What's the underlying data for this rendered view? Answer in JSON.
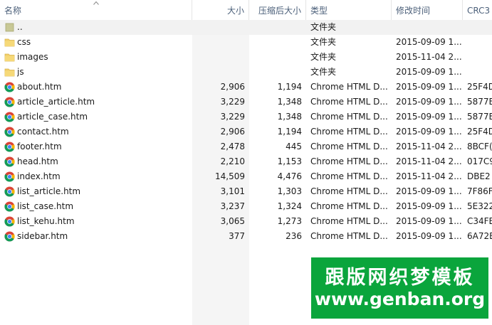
{
  "columns": {
    "name": "名称",
    "size": "大小",
    "packed": "压缩后大小",
    "type": "类型",
    "modified": "修改时间",
    "crc": "CRC3"
  },
  "files": [
    {
      "name": "..",
      "icon": "folder-up-icon",
      "size": "",
      "packed": "",
      "type": "文件夹",
      "modified": "",
      "crc": ""
    },
    {
      "name": "css",
      "icon": "folder-icon",
      "size": "",
      "packed": "",
      "type": "文件夹",
      "modified": "2015-09-09 1...",
      "crc": ""
    },
    {
      "name": "images",
      "icon": "folder-icon",
      "size": "",
      "packed": "",
      "type": "文件夹",
      "modified": "2015-11-04 2...",
      "crc": ""
    },
    {
      "name": "js",
      "icon": "folder-icon",
      "size": "",
      "packed": "",
      "type": "文件夹",
      "modified": "2015-09-09 1...",
      "crc": ""
    },
    {
      "name": "about.htm",
      "icon": "chrome-icon",
      "size": "2,906",
      "packed": "1,194",
      "type": "Chrome HTML D...",
      "modified": "2015-09-09 1...",
      "crc": "25F4D"
    },
    {
      "name": "article_article.htm",
      "icon": "chrome-icon",
      "size": "3,229",
      "packed": "1,348",
      "type": "Chrome HTML D...",
      "modified": "2015-09-09 1...",
      "crc": "5877E"
    },
    {
      "name": "article_case.htm",
      "icon": "chrome-icon",
      "size": "3,229",
      "packed": "1,348",
      "type": "Chrome HTML D...",
      "modified": "2015-09-09 1...",
      "crc": "5877E"
    },
    {
      "name": "contact.htm",
      "icon": "chrome-icon",
      "size": "2,906",
      "packed": "1,194",
      "type": "Chrome HTML D...",
      "modified": "2015-09-09 1...",
      "crc": "25F4D"
    },
    {
      "name": "footer.htm",
      "icon": "chrome-icon",
      "size": "2,478",
      "packed": "445",
      "type": "Chrome HTML D...",
      "modified": "2015-11-04 2...",
      "crc": "8BCF("
    },
    {
      "name": "head.htm",
      "icon": "chrome-icon",
      "size": "2,210",
      "packed": "1,153",
      "type": "Chrome HTML D...",
      "modified": "2015-11-04 2...",
      "crc": "017C9"
    },
    {
      "name": "index.htm",
      "icon": "chrome-icon",
      "size": "14,509",
      "packed": "4,476",
      "type": "Chrome HTML D...",
      "modified": "2015-11-04 2...",
      "crc": "DBE2"
    },
    {
      "name": "list_article.htm",
      "icon": "chrome-icon",
      "size": "3,101",
      "packed": "1,303",
      "type": "Chrome HTML D...",
      "modified": "2015-09-09 1...",
      "crc": "7F86F"
    },
    {
      "name": "list_case.htm",
      "icon": "chrome-icon",
      "size": "3,237",
      "packed": "1,324",
      "type": "Chrome HTML D...",
      "modified": "2015-09-09 1...",
      "crc": "5E322"
    },
    {
      "name": "list_kehu.htm",
      "icon": "chrome-icon",
      "size": "3,065",
      "packed": "1,273",
      "type": "Chrome HTML D...",
      "modified": "2015-09-09 1...",
      "crc": "C34FE"
    },
    {
      "name": "sidebar.htm",
      "icon": "chrome-icon",
      "size": "377",
      "packed": "236",
      "type": "Chrome HTML D...",
      "modified": "2015-09-09 1...",
      "crc": "6A72E"
    }
  ],
  "watermark": {
    "title": "跟版网织梦模板",
    "url": "www.genban.org"
  },
  "colors": {
    "selected_row": "#f2f2f2",
    "folder": "#f1cf6b",
    "watermark_bg": "#0aa53c"
  }
}
